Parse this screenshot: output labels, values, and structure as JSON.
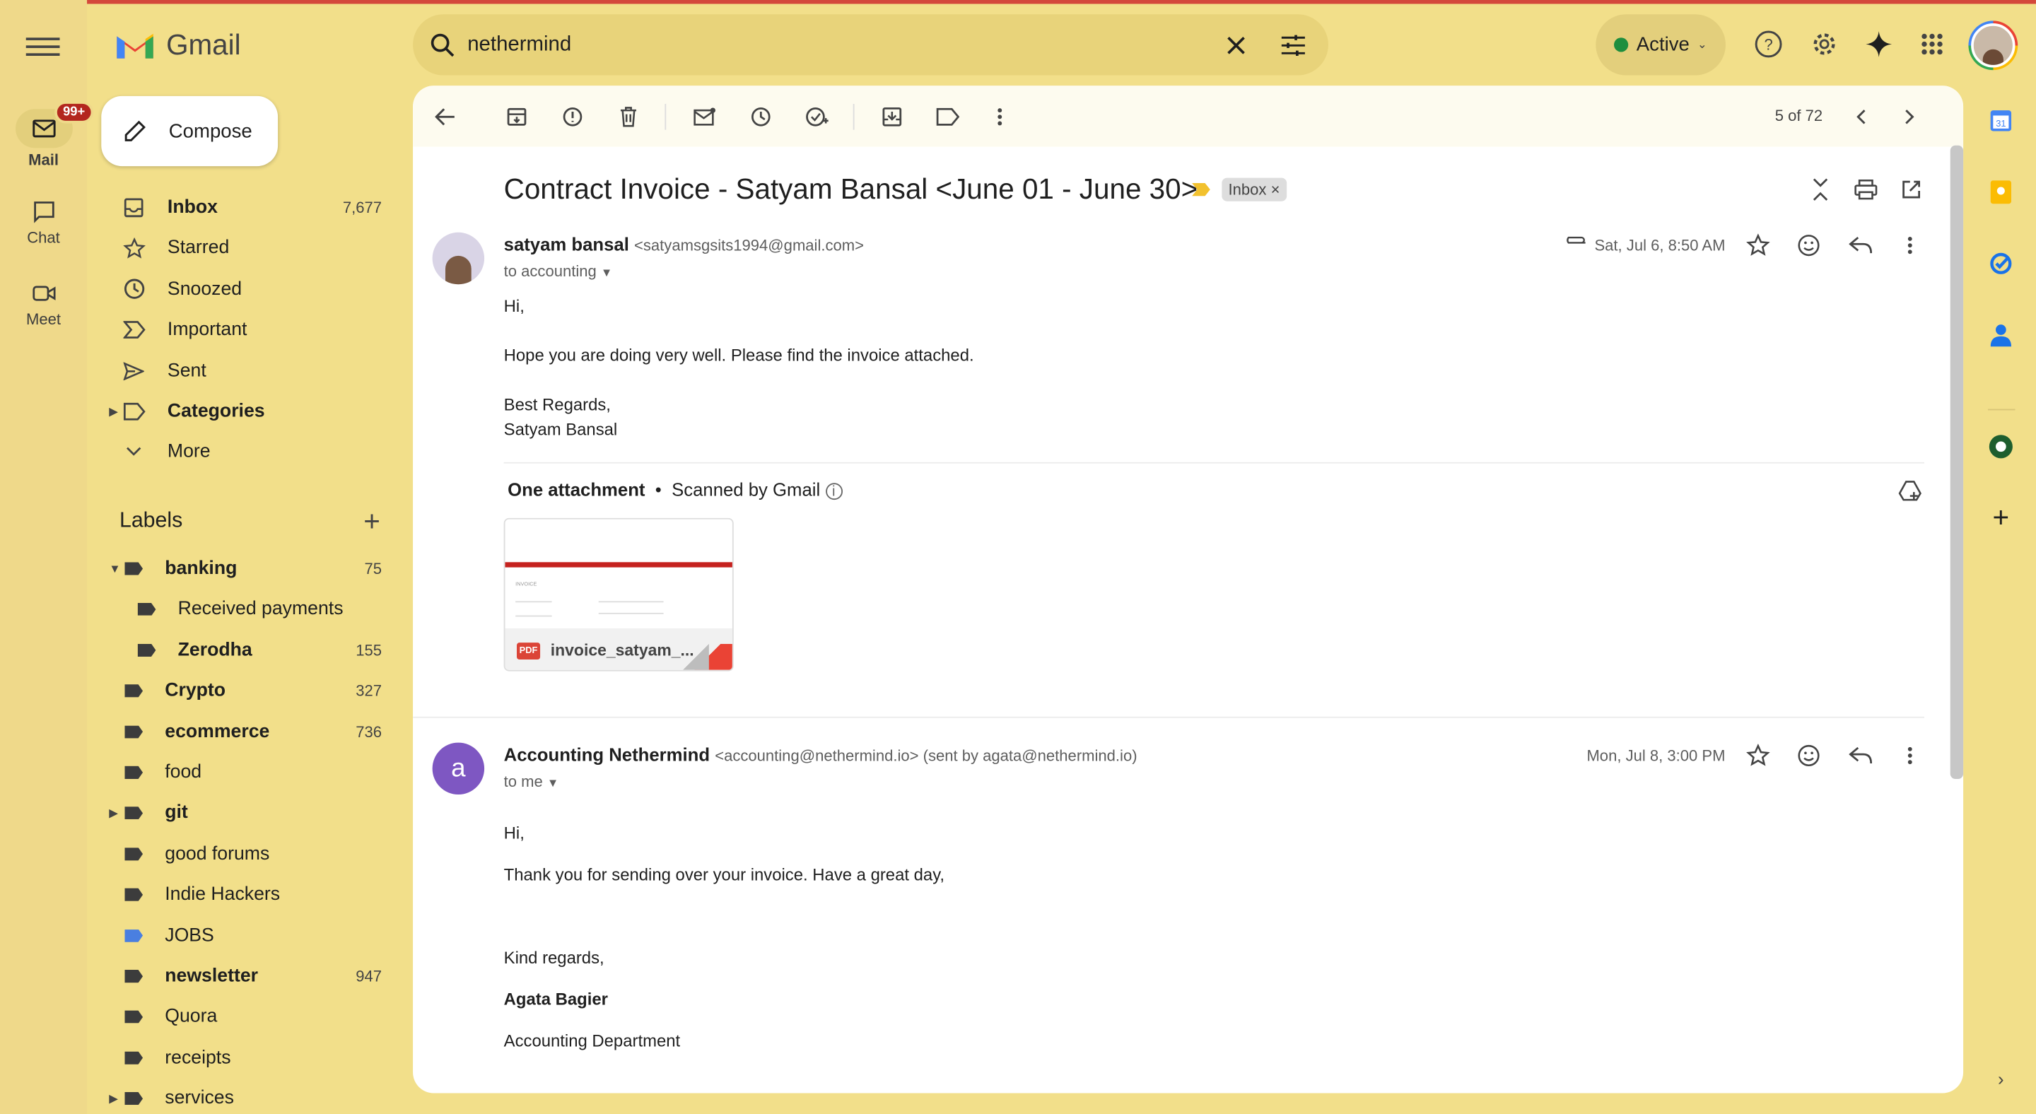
{
  "app": {
    "name": "Gmail"
  },
  "rail": {
    "mail": "Mail",
    "chat": "Chat",
    "meet": "Meet",
    "badge": "99+"
  },
  "search": {
    "query": "nethermind"
  },
  "status": {
    "label": "Active",
    "color": "#1e8e3e"
  },
  "compose": {
    "label": "Compose"
  },
  "nav": [
    {
      "label": "Inbox",
      "count": "7,677",
      "icon": "inbox-icon"
    },
    {
      "label": "Starred",
      "count": "",
      "icon": "star-icon"
    },
    {
      "label": "Snoozed",
      "count": "",
      "icon": "clock-icon"
    },
    {
      "label": "Important",
      "count": "",
      "icon": "important-icon"
    },
    {
      "label": "Sent",
      "count": "",
      "icon": "send-icon"
    },
    {
      "label": "Categories",
      "count": "",
      "icon": "label-outline-icon"
    },
    {
      "label": "More",
      "count": "",
      "icon": "chevron-down-icon"
    }
  ],
  "labels": {
    "heading": "Labels",
    "items": [
      {
        "label": "banking",
        "count": "75"
      },
      {
        "label": "Received payments",
        "count": ""
      },
      {
        "label": "Zerodha",
        "count": "155"
      },
      {
        "label": "Crypto",
        "count": "327"
      },
      {
        "label": "ecommerce",
        "count": "736"
      },
      {
        "label": "food",
        "count": ""
      },
      {
        "label": "git",
        "count": ""
      },
      {
        "label": "good forums",
        "count": ""
      },
      {
        "label": "Indie Hackers",
        "count": ""
      },
      {
        "label": "JOBS",
        "count": ""
      },
      {
        "label": "newsletter",
        "count": "947"
      },
      {
        "label": "Quora",
        "count": ""
      },
      {
        "label": "receipts",
        "count": ""
      },
      {
        "label": "services",
        "count": ""
      }
    ]
  },
  "toolbar": {
    "pager": "5 of 72"
  },
  "thread": {
    "subject": "Contract Invoice - Satyam Bansal <June 01 - June 30>",
    "chip": "Inbox",
    "messages": [
      {
        "sender": "satyam bansal",
        "email": "<satyamsgsits1994@gmail.com>",
        "to": "to accounting",
        "date": "Sat, Jul 6, 8:50 AM",
        "body": [
          "Hi,",
          "Hope you are doing very well. Please find the invoice attached.",
          "Best Regards,",
          "Satyam Bansal"
        ],
        "attachment_heading": "One attachment",
        "scanned": "Scanned by Gmail",
        "attachment_name": "invoice_satyam_...",
        "attachment_type": "PDF",
        "preview_title": "INVOICE"
      },
      {
        "sender": "Accounting Nethermind",
        "email": "<accounting@nethermind.io> (sent by agata@nethermind.io)",
        "to": "to me",
        "date": "Mon, Jul 8, 3:00 PM",
        "avatar_letter": "a",
        "body": [
          "Hi,",
          "Thank you for sending over your invoice. Have a great day,",
          "Kind regards,",
          "Agata Bagier",
          "Accounting Department"
        ]
      }
    ]
  }
}
